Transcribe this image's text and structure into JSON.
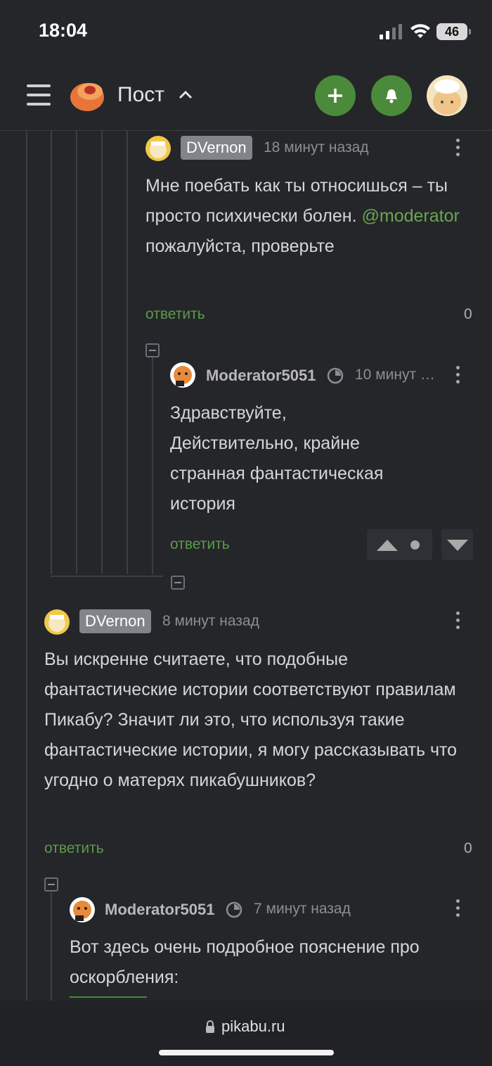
{
  "status": {
    "time": "18:04",
    "battery": "46"
  },
  "header": {
    "title": "Пост"
  },
  "comments": [
    {
      "username": "DVernon",
      "time": "18 минут назад",
      "text_before": "Мне поебать как ты относишься – ты просто психически болен.",
      "mention": "@moderator",
      "text_after": " пожалуйста, проверьте",
      "reply": "ответить",
      "rating": "0"
    },
    {
      "username": "Moderator5051",
      "time": "10 минут …",
      "text": "Здравствуйте,\nДействительно, крайне странная фантастическая история",
      "reply": "ответить"
    },
    {
      "username": "DVernon",
      "time": "8 минут назад",
      "text": "Вы искренне считаете, что подобные фантастические истории соответствуют правилам Пикабу? Значит ли это, что используя такие фантастические истории, я могу рассказывать что угодно о матерях пикабушников?",
      "reply": "ответить",
      "rating": "0"
    },
    {
      "username": "Moderator5051",
      "time": "7 минут назад",
      "text": "Вот здесь очень подробное пояснение про оскорбления:"
    }
  ],
  "bottom": {
    "url": "pikabu.ru"
  },
  "colors": {
    "accent": "#4b8a3a",
    "link": "#5e9a47",
    "background": "#24262a"
  }
}
